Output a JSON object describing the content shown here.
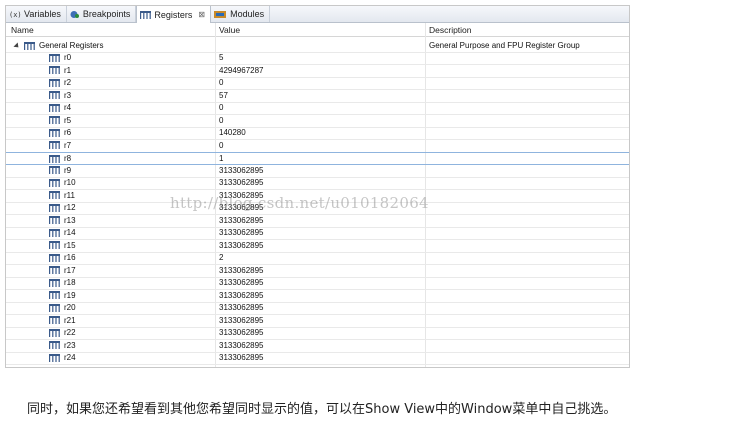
{
  "tabs": [
    {
      "label": "Variables",
      "icon": "variables-icon",
      "active": false
    },
    {
      "label": "Breakpoints",
      "icon": "breakpoints-icon",
      "active": false
    },
    {
      "label": "Registers",
      "icon": "registers-icon",
      "active": true,
      "close": "⊠"
    },
    {
      "label": "Modules",
      "icon": "modules-icon",
      "active": false
    }
  ],
  "columns": {
    "name": "Name",
    "value": "Value",
    "description": "Description"
  },
  "group": {
    "name": "General Registers",
    "description": "General Purpose and FPU Register Group"
  },
  "registers": [
    {
      "name": "r0",
      "value": "5"
    },
    {
      "name": "r1",
      "value": "4294967287"
    },
    {
      "name": "r2",
      "value": "0"
    },
    {
      "name": "r3",
      "value": "57"
    },
    {
      "name": "r4",
      "value": "0"
    },
    {
      "name": "r5",
      "value": "0"
    },
    {
      "name": "r6",
      "value": "140280"
    },
    {
      "name": "r7",
      "value": "0"
    },
    {
      "name": "r8",
      "value": "1"
    },
    {
      "name": "r9",
      "value": "3133062895"
    },
    {
      "name": "r10",
      "value": "3133062895"
    },
    {
      "name": "r11",
      "value": "3133062895"
    },
    {
      "name": "r12",
      "value": "3133062895"
    },
    {
      "name": "r13",
      "value": "3133062895"
    },
    {
      "name": "r14",
      "value": "3133062895"
    },
    {
      "name": "r15",
      "value": "3133062895"
    },
    {
      "name": "r16",
      "value": "2"
    },
    {
      "name": "r17",
      "value": "3133062895"
    },
    {
      "name": "r18",
      "value": "3133062895"
    },
    {
      "name": "r19",
      "value": "3133062895"
    },
    {
      "name": "r20",
      "value": "3133062895"
    },
    {
      "name": "r21",
      "value": "3133062895"
    },
    {
      "name": "r22",
      "value": "3133062895"
    },
    {
      "name": "r23",
      "value": "3133062895"
    },
    {
      "name": "r24",
      "value": "3133062895"
    }
  ],
  "selected_register": "r8",
  "watermark": "http://blog.csdn.net/u010182064",
  "caption": "同时，如果您还希望看到其他您希望同时显示的值，可以在Show View中的Window菜单中自己挑选。",
  "colors": {
    "selection_border": "#8fb4de",
    "register_icon": "#3a5a8a"
  }
}
